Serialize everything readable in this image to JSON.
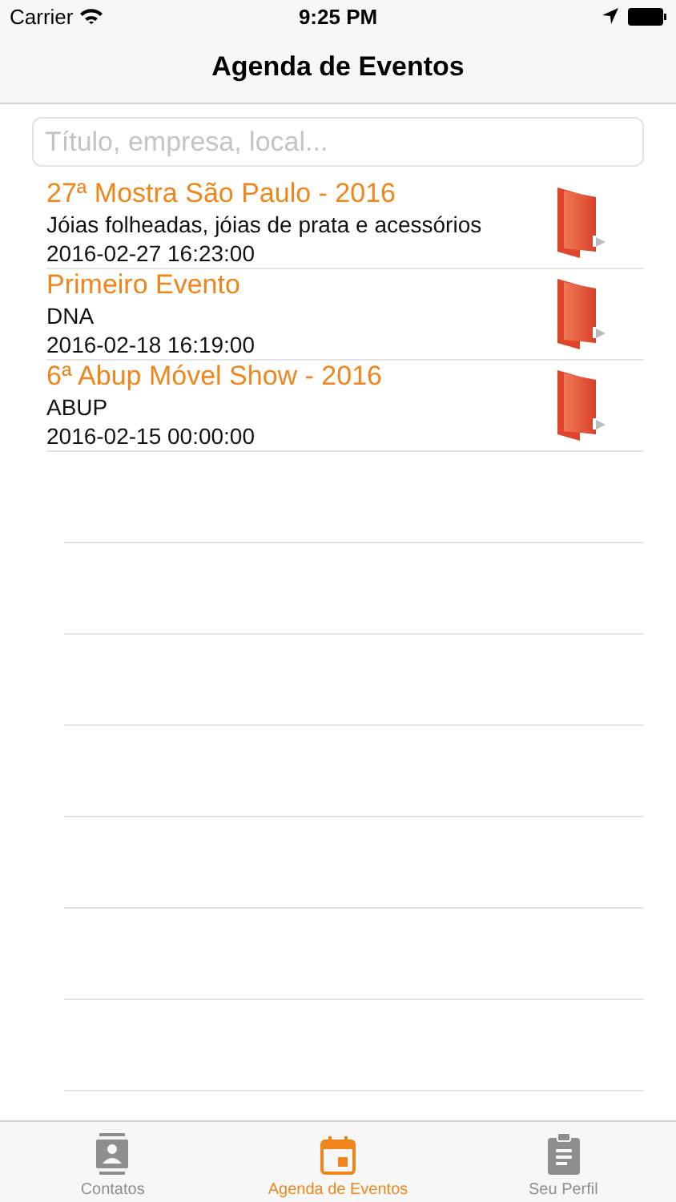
{
  "status_bar": {
    "carrier": "Carrier",
    "time": "9:25 PM"
  },
  "nav_bar": {
    "title": "Agenda de Eventos"
  },
  "search": {
    "placeholder": "Título, empresa, local..."
  },
  "events": [
    {
      "title": "27ª Mostra São Paulo - 2016",
      "subtitle": "Jóias folheadas, jóias de prata e acessórios",
      "date": "2016-02-27 16:23:00"
    },
    {
      "title": "Primeiro Evento",
      "subtitle": "DNA",
      "date": "2016-02-18 16:19:00"
    },
    {
      "title": "6ª Abup Móvel Show - 2016",
      "subtitle": "ABUP",
      "date": "2016-02-15 00:00:00"
    }
  ],
  "tabs": [
    {
      "label": "Contatos",
      "kind": "contacts",
      "selected": false
    },
    {
      "label": "Agenda de Eventos",
      "kind": "calendar",
      "selected": true
    },
    {
      "label": "Seu Perfil",
      "kind": "clipboard",
      "selected": false
    }
  ]
}
